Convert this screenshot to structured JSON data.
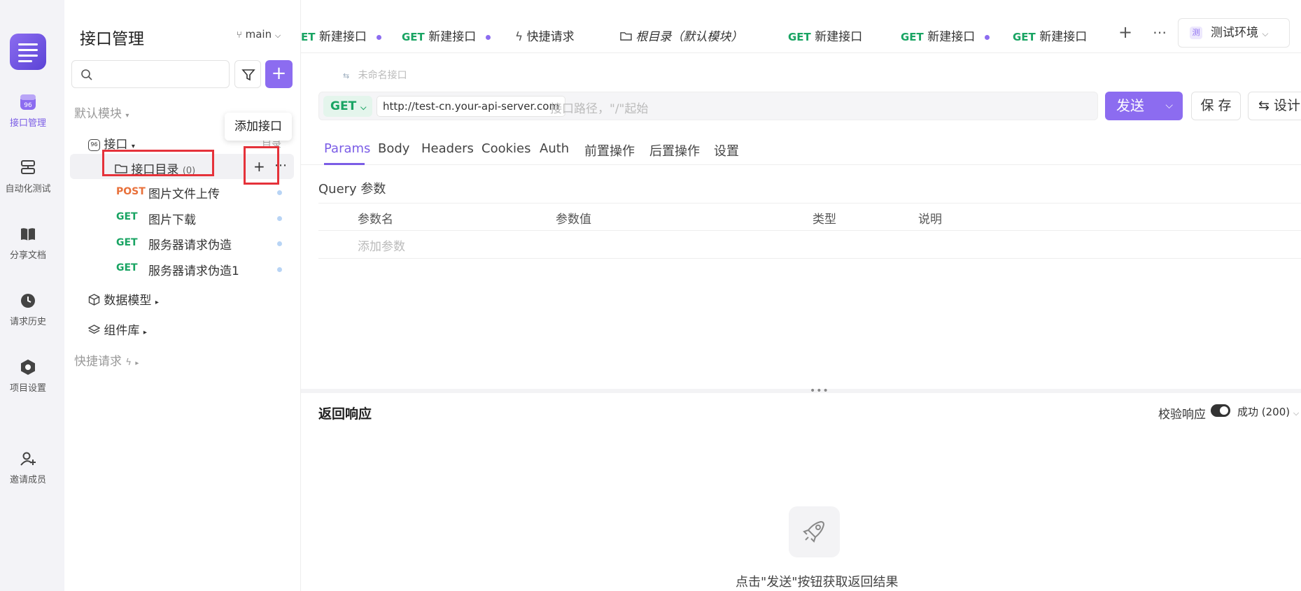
{
  "rail": {
    "items": [
      {
        "label": "接口管理",
        "icon": "api-management-icon"
      },
      {
        "label": "自动化测试",
        "icon": "automation-icon"
      },
      {
        "label": "分享文档",
        "icon": "book-icon"
      },
      {
        "label": "请求历史",
        "icon": "clock-icon"
      },
      {
        "label": "项目设置",
        "icon": "settings-hex-icon"
      },
      {
        "label": "邀请成员",
        "icon": "add-user-icon"
      }
    ]
  },
  "sidebar": {
    "title": "接口管理",
    "branch": "main",
    "default_module": "默认模块",
    "api_node": "接口",
    "folder": {
      "label": "接口目录",
      "count": "(0)"
    },
    "tooltip": "添加接口",
    "hidden_label": "目录",
    "endpoints": [
      {
        "method": "POST",
        "name": "图片文件上传"
      },
      {
        "method": "GET",
        "name": "图片下载"
      },
      {
        "method": "GET",
        "name": "服务器请求伪造"
      },
      {
        "method": "GET",
        "name": "服务器请求伪造1"
      }
    ],
    "data_model": "数据模型",
    "components": "组件库",
    "quick_request": "快捷请求"
  },
  "tabs": [
    {
      "method": "ET",
      "label": "新建接口",
      "dot": true
    },
    {
      "method": "GET",
      "label": "新建接口",
      "dot": true
    },
    {
      "method": "",
      "label": "快捷请求",
      "dot": false
    },
    {
      "method": "",
      "label": "根目录（默认模块）",
      "dot": false
    },
    {
      "method": "GET",
      "label": "新建接口",
      "dot": false
    },
    {
      "method": "GET",
      "label": "新建接口",
      "dot": true
    },
    {
      "method": "GET",
      "label": "新建接口",
      "dot": false
    }
  ],
  "env": {
    "label": "测试环境"
  },
  "request": {
    "name_placeholder": "未命名接口",
    "method": "GET",
    "base_url": "http://test-cn.your-api-server.com",
    "path_placeholder": "接口路径，\"/\"起始",
    "send_label": "发送",
    "save_label": "保 存",
    "design_label": "设计"
  },
  "subtabs": [
    "Params",
    "Body",
    "Headers",
    "Cookies",
    "Auth",
    "前置操作",
    "后置操作",
    "设置"
  ],
  "params": {
    "section_label": "Query 参数",
    "columns": [
      "参数名",
      "参数值",
      "类型",
      "说明"
    ],
    "add_placeholder": "添加参数"
  },
  "response": {
    "title": "返回响应",
    "verify_label": "校验响应",
    "status": "成功 (200)",
    "empty_hint": "点击\"发送\"按钮获取返回结果"
  },
  "colors": {
    "accent": "#8c6cf0",
    "get": "#19a463",
    "post": "#e8703a",
    "highlight": "#e5323a"
  }
}
